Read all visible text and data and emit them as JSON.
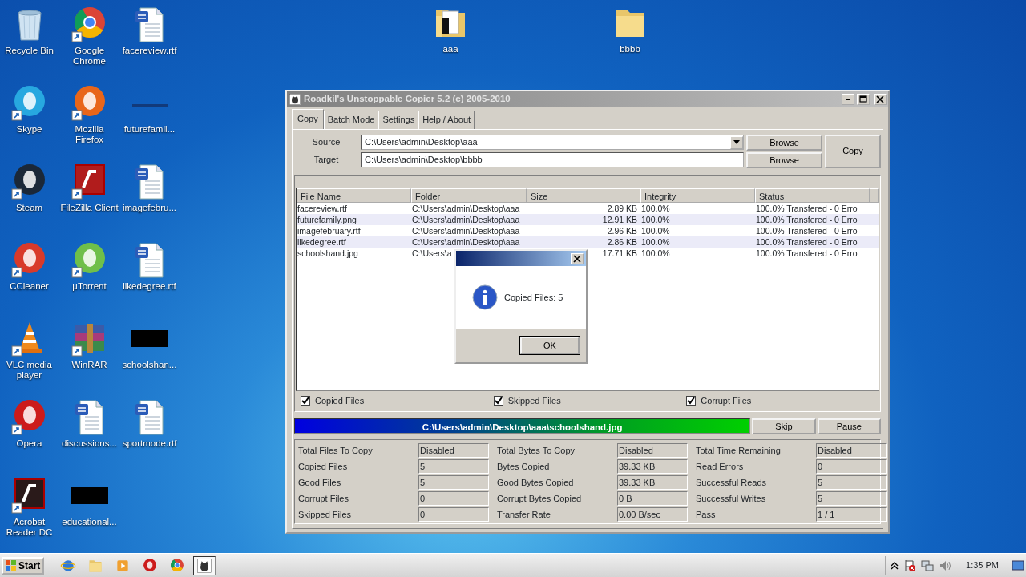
{
  "desktop": {
    "icons": [
      {
        "label": "Recycle Bin",
        "kind": "bin",
        "shortcut": false
      },
      {
        "label": "Skype",
        "kind": "round",
        "color": "#27a8e0",
        "shortcut": true
      },
      {
        "label": "Steam",
        "kind": "round",
        "color": "#1b2838",
        "shortcut": true
      },
      {
        "label": "CCleaner",
        "kind": "round",
        "color": "#d83a2a",
        "shortcut": true
      },
      {
        "label": "VLC media player",
        "kind": "cone",
        "shortcut": true
      },
      {
        "label": "Opera",
        "kind": "round",
        "color": "#cc1b1b",
        "shortcut": true
      },
      {
        "label": "Acrobat Reader DC",
        "kind": "square",
        "color": "#2a1a1a",
        "shortcut": true
      },
      {
        "label": "Google Chrome",
        "kind": "ring",
        "shortcut": true
      },
      {
        "label": "Mozilla Firefox",
        "kind": "round",
        "color": "#e8661a",
        "shortcut": true
      },
      {
        "label": "FileZilla Client",
        "kind": "square",
        "color": "#b11c1c",
        "shortcut": true
      },
      {
        "label": "µTorrent",
        "kind": "round",
        "color": "#6fbf4a",
        "shortcut": true
      },
      {
        "label": "WinRAR",
        "kind": "stack",
        "shortcut": true
      },
      {
        "label": "discussions...",
        "kind": "doc",
        "shortcut": false
      },
      {
        "label": "educational...",
        "kind": "redacted",
        "shortcut": false
      },
      {
        "label": "facereview.rtf",
        "kind": "doc",
        "shortcut": false
      },
      {
        "label": "futurefamil...",
        "kind": "thumb",
        "shortcut": false
      },
      {
        "label": "imagefebru...",
        "kind": "doc",
        "shortcut": false
      },
      {
        "label": "likedegree.rtf",
        "kind": "doc",
        "shortcut": false
      },
      {
        "label": "schoolshan...",
        "kind": "redacted",
        "shortcut": false
      },
      {
        "label": "sportmode.rtf",
        "kind": "doc",
        "shortcut": false
      }
    ],
    "folders": [
      {
        "label": "aaa",
        "kind": "folder-files"
      },
      {
        "label": "bbbb",
        "kind": "folder"
      }
    ]
  },
  "window": {
    "title": "Roadkil's Unstoppable Copier 5.2 (c) 2005-2010",
    "tabs": [
      {
        "label": "Copy",
        "selected": true
      },
      {
        "label": "Batch Mode",
        "selected": false
      },
      {
        "label": "Settings",
        "selected": false
      },
      {
        "label": "Help / About",
        "selected": false
      }
    ],
    "source": {
      "label": "Source",
      "value": "C:\\Users\\admin\\Desktop\\aaa",
      "browse": "Browse"
    },
    "target": {
      "label": "Target",
      "value": "C:\\Users\\admin\\Desktop\\bbbb",
      "browse": "Browse"
    },
    "copy_button": "Copy",
    "table": {
      "columns": [
        "File Name",
        "Folder",
        "Size",
        "Integrity",
        "Status"
      ],
      "rows": [
        [
          "facereview.rtf",
          "C:\\Users\\admin\\Desktop\\aaa",
          "2.89 KB",
          "100.0%",
          "100.0% Transfered - 0 Erro"
        ],
        [
          "futurefamily.png",
          "C:\\Users\\admin\\Desktop\\aaa",
          "12.91 KB",
          "100.0%",
          "100.0% Transfered - 0 Erro"
        ],
        [
          "imagefebruary.rtf",
          "C:\\Users\\admin\\Desktop\\aaa",
          "2.96 KB",
          "100.0%",
          "100.0% Transfered - 0 Erro"
        ],
        [
          "likedegree.rtf",
          "C:\\Users\\admin\\Desktop\\aaa",
          "2.86 KB",
          "100.0%",
          "100.0% Transfered - 0 Erro"
        ],
        [
          "schoolshand.jpg",
          "C:\\Users\\a",
          "17.71 KB",
          "100.0%",
          "100.0% Transfered - 0 Erro"
        ]
      ]
    },
    "filters": [
      {
        "label": "Copied Files",
        "checked": true
      },
      {
        "label": "Skipped Files",
        "checked": true
      },
      {
        "label": "Corrupt Files",
        "checked": true
      }
    ],
    "progress": {
      "text": "C:\\Users\\admin\\Desktop\\aaa\\schoolshand.jpg",
      "level": 1
    },
    "progress_buttons": [
      "Skip",
      "Pause"
    ],
    "stats": [
      [
        {
          "label": "Total Files To Copy",
          "value": "Disabled"
        },
        {
          "label": "Copied Files",
          "value": "5"
        },
        {
          "label": "Good Files",
          "value": "5"
        },
        {
          "label": "Corrupt Files",
          "value": "0"
        },
        {
          "label": "Skipped Files",
          "value": "0"
        }
      ],
      [
        {
          "label": "Total Bytes To Copy",
          "value": "Disabled"
        },
        {
          "label": "Bytes Copied",
          "value": "39.33 KB"
        },
        {
          "label": "Good Bytes Copied",
          "value": "39.33 KB"
        },
        {
          "label": "Corrupt Bytes Copied",
          "value": "0 B"
        },
        {
          "label": "Transfer Rate",
          "value": "0.00 B/sec"
        }
      ],
      [
        {
          "label": "Total Time Remaining",
          "value": "Disabled"
        },
        {
          "label": "Read Errors",
          "value": "0"
        },
        {
          "label": "Successful Reads",
          "value": "5"
        },
        {
          "label": "Successful Writes",
          "value": "5"
        },
        {
          "label": "Pass",
          "value": "1 / 1"
        }
      ]
    ]
  },
  "dialog": {
    "message": "Copied Files: 5",
    "button": "OK"
  },
  "taskbar": {
    "start": "Start",
    "apps": [
      {
        "kind": "globe",
        "selected": false
      },
      {
        "kind": "folder",
        "selected": false
      },
      {
        "kind": "player",
        "selected": false
      },
      {
        "kind": "round",
        "color": "#cc1b1b",
        "selected": false
      },
      {
        "kind": "ring",
        "selected": false
      },
      {
        "kind": "app",
        "selected": true
      }
    ],
    "clock": "1:35 PM"
  }
}
